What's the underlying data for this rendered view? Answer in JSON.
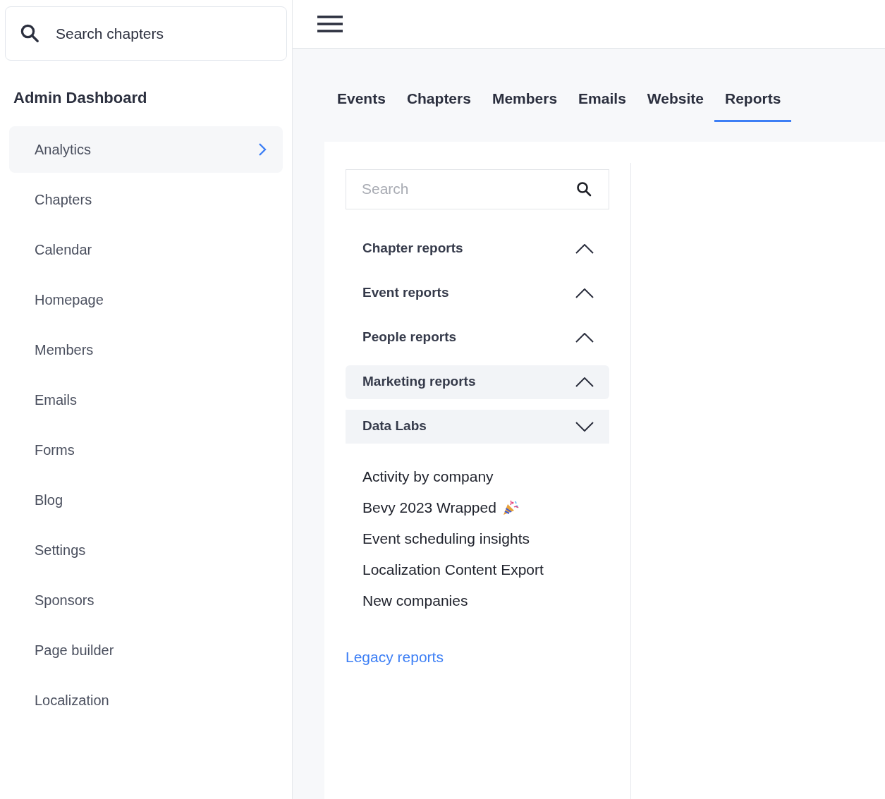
{
  "sidebar": {
    "search": {
      "placeholder": "Search chapters"
    },
    "title": "Admin Dashboard",
    "items": [
      {
        "label": "Analytics",
        "selected": true
      },
      {
        "label": "Chapters",
        "selected": false
      },
      {
        "label": "Calendar",
        "selected": false
      },
      {
        "label": "Homepage",
        "selected": false
      },
      {
        "label": "Members",
        "selected": false
      },
      {
        "label": "Emails",
        "selected": false
      },
      {
        "label": "Forms",
        "selected": false
      },
      {
        "label": "Blog",
        "selected": false
      },
      {
        "label": "Settings",
        "selected": false
      },
      {
        "label": "Sponsors",
        "selected": false
      },
      {
        "label": "Page builder",
        "selected": false
      },
      {
        "label": "Localization",
        "selected": false
      }
    ]
  },
  "tabs": [
    {
      "label": "Events",
      "selected": false
    },
    {
      "label": "Chapters",
      "selected": false
    },
    {
      "label": "Members",
      "selected": false
    },
    {
      "label": "Emails",
      "selected": false
    },
    {
      "label": "Website",
      "selected": false
    },
    {
      "label": "Reports",
      "selected": true
    }
  ],
  "reports": {
    "search": {
      "placeholder": "Search"
    },
    "sections": [
      {
        "title": "Chapter reports",
        "expanded": false,
        "highlighted": false
      },
      {
        "title": "Event reports",
        "expanded": false,
        "highlighted": false
      },
      {
        "title": "People reports",
        "expanded": false,
        "highlighted": false
      },
      {
        "title": "Marketing reports",
        "expanded": false,
        "highlighted": true
      },
      {
        "title": "Data Labs",
        "expanded": true,
        "highlighted": true,
        "items": [
          {
            "label": "Activity by company",
            "kind": "plain"
          },
          {
            "label": "Bevy 2023 Wrapped",
            "kind": "celebration"
          },
          {
            "label": "Event scheduling insights",
            "kind": "plain"
          },
          {
            "label": "Localization Content Export",
            "kind": "plain"
          },
          {
            "label": "New companies",
            "kind": "plain"
          }
        ]
      }
    ],
    "link": "Legacy reports"
  }
}
